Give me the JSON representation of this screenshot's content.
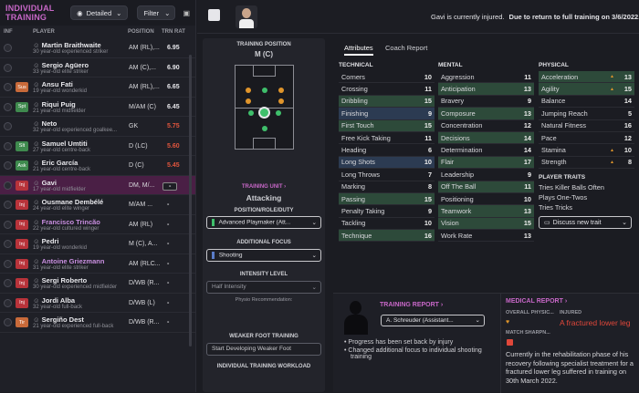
{
  "header": {
    "title": "INDIVIDUAL TRAINING",
    "view": "Detailed",
    "filter": "Filter"
  },
  "columns": {
    "inf": "INF",
    "player": "PLAYER",
    "position": "POSITION",
    "rating": "TRN RAT"
  },
  "players": [
    {
      "name": "Martin Braithwaite",
      "desc": "30 year-old experienced striker",
      "pos": "AM (RL),...",
      "rating": "6.95",
      "badge": "",
      "color": "#e6e6ea"
    },
    {
      "name": "Sergio Agüero",
      "desc": "33 year-old elite striker",
      "pos": "AM (C),...",
      "rating": "6.90",
      "badge": "",
      "color": "#e6e6ea"
    },
    {
      "name": "Ansu Fati",
      "desc": "19 year-old wonderkid",
      "pos": "AM (RL),...",
      "rating": "6.65",
      "badge": "Sus",
      "color": "#e6e6ea"
    },
    {
      "name": "Riqui Puig",
      "desc": "21 year-old midfielder",
      "pos": "M/AM (C)",
      "rating": "6.45",
      "badge": "Spt",
      "color": "#e6e6ea"
    },
    {
      "name": "Neto",
      "desc": "32 year-old experienced goalkee...",
      "pos": "GK",
      "rating": "5.75",
      "badge": "",
      "color": "#e0553d"
    },
    {
      "name": "Samuel Umtiti",
      "desc": "27 year-old centre-back",
      "pos": "D (LC)",
      "rating": "5.60",
      "badge": "Slt",
      "color": "#e0553d"
    },
    {
      "name": "Eric García",
      "desc": "21 year-old centre-back",
      "pos": "D (C)",
      "rating": "5.45",
      "badge": "Ask",
      "color": "#e0553d"
    },
    {
      "name": "Gavi",
      "desc": "17 year-old midfielder",
      "pos": "DM, M/...",
      "rating": "-",
      "badge": "Inj",
      "color": "#e6e6ea",
      "selected": true
    },
    {
      "name": "Ousmane Dembélé",
      "desc": "24 year-old elite winger",
      "pos": "M/AM ...",
      "rating": "-",
      "badge": "Inj",
      "color": "#e6e6ea"
    },
    {
      "name": "Francisco Trincão",
      "desc": "22 year-old cultured winger",
      "pos": "AM (RL)",
      "rating": "-",
      "badge": "Inj",
      "color": "#e6e6ea",
      "purple": true
    },
    {
      "name": "Pedri",
      "desc": "19 year-old wonderkid",
      "pos": "M (C), A...",
      "rating": "-",
      "badge": "Inj",
      "color": "#e6e6ea"
    },
    {
      "name": "Antoine Griezmann",
      "desc": "31 year-old elite striker",
      "pos": "AM (RLC...",
      "rating": "-",
      "badge": "Inj",
      "color": "#e6e6ea",
      "purple": true
    },
    {
      "name": "Sergi Roberto",
      "desc": "30 year-old experienced midfielder",
      "pos": "D/WB (R...",
      "rating": "-",
      "badge": "Inj",
      "color": "#e6e6ea"
    },
    {
      "name": "Jordi Alba",
      "desc": "32 year-old full-back",
      "pos": "D/WB (L)",
      "rating": "-",
      "badge": "Inj",
      "color": "#e6e6ea"
    },
    {
      "name": "Sergiño Dest",
      "desc": "21 year-old experienced full-back",
      "pos": "D/WB (R...",
      "rating": "-",
      "badge": "Tir",
      "color": "#e6e6ea"
    }
  ],
  "topbar": {
    "status": "Gavi is currently injured.",
    "status_bold": "Due to return to full training on 3/6/2022."
  },
  "middle": {
    "training_position_label": "TRAINING POSITION",
    "training_position": "M (C)",
    "training_unit_label": "TRAINING UNIT",
    "training_unit": "Attacking",
    "role_label": "POSITION/ROLE/DUTY",
    "role": "Advanced Playmaker (Att...",
    "focus_label": "ADDITIONAL FOCUS",
    "focus": "Shooting",
    "intensity_label": "INTENSITY LEVEL",
    "intensity": "Half Intensity",
    "physio": "Physio Recommendation:",
    "weak_foot_label": "WEAKER FOOT TRAINING",
    "weak_foot": "Start Developing Weaker Foot",
    "workload_label": "INDIVIDUAL TRAINING WORKLOAD"
  },
  "tabs": [
    "Attributes",
    "Coach Report"
  ],
  "technical": {
    "title": "TECHNICAL",
    "items": [
      [
        "Corners",
        "10",
        ""
      ],
      [
        "Crossing",
        "11",
        ""
      ],
      [
        "Dribbling",
        "15",
        "hl"
      ],
      [
        "Finishing",
        "9",
        "hb"
      ],
      [
        "First Touch",
        "15",
        "hl"
      ],
      [
        "Free Kick Taking",
        "11",
        ""
      ],
      [
        "Heading",
        "6",
        ""
      ],
      [
        "Long Shots",
        "10",
        "hb"
      ],
      [
        "Long Throws",
        "7",
        ""
      ],
      [
        "Marking",
        "8",
        ""
      ],
      [
        "Passing",
        "15",
        "hl"
      ],
      [
        "Penalty Taking",
        "9",
        ""
      ],
      [
        "Tackling",
        "10",
        ""
      ],
      [
        "Technique",
        "16",
        "hl"
      ]
    ]
  },
  "mental": {
    "title": "MENTAL",
    "items": [
      [
        "Aggression",
        "11",
        ""
      ],
      [
        "Anticipation",
        "13",
        "hl"
      ],
      [
        "Bravery",
        "9",
        ""
      ],
      [
        "Composure",
        "13",
        "hl"
      ],
      [
        "Concentration",
        "12",
        ""
      ],
      [
        "Decisions",
        "14",
        "hl"
      ],
      [
        "Determination",
        "14",
        ""
      ],
      [
        "Flair",
        "17",
        "hl"
      ],
      [
        "Leadership",
        "9",
        ""
      ],
      [
        "Off The Ball",
        "11",
        "hl"
      ],
      [
        "Positioning",
        "10",
        ""
      ],
      [
        "Teamwork",
        "13",
        "hl"
      ],
      [
        "Vision",
        "15",
        "hl"
      ],
      [
        "Work Rate",
        "13",
        ""
      ]
    ]
  },
  "physical": {
    "title": "PHYSICAL",
    "items": [
      [
        "Acceleration",
        "13",
        "hl"
      ],
      [
        "Agility",
        "15",
        "hl"
      ],
      [
        "Balance",
        "14",
        ""
      ],
      [
        "Jumping Reach",
        "5",
        ""
      ],
      [
        "Natural Fitness",
        "16",
        ""
      ],
      [
        "Pace",
        "12",
        ""
      ],
      [
        "Stamina",
        "10",
        ""
      ],
      [
        "Strength",
        "8",
        ""
      ]
    ]
  },
  "traits": {
    "title": "PLAYER TRAITS",
    "items": [
      "Tries Killer Balls Often",
      "Plays One-Twos",
      "Tries Tricks"
    ],
    "button": "Discuss new trait"
  },
  "report": {
    "title": "TRAINING REPORT",
    "coach": "A. Schreuder (Assistant...",
    "bullets": [
      "Progress has been set back by injury",
      "Changed additional focus to individual shooting training"
    ]
  },
  "medical": {
    "title": "MEDICAL REPORT",
    "overall": "OVERALL PHYSIC...",
    "injured": "INJURED",
    "injury": "A fractured lower leg",
    "sharpness": "MATCH SHARPN...",
    "text": "Currently in the rehabilitation phase of his recovery following specialist treatment for a fractured lower leg suffered in training on 30th March 2022."
  }
}
